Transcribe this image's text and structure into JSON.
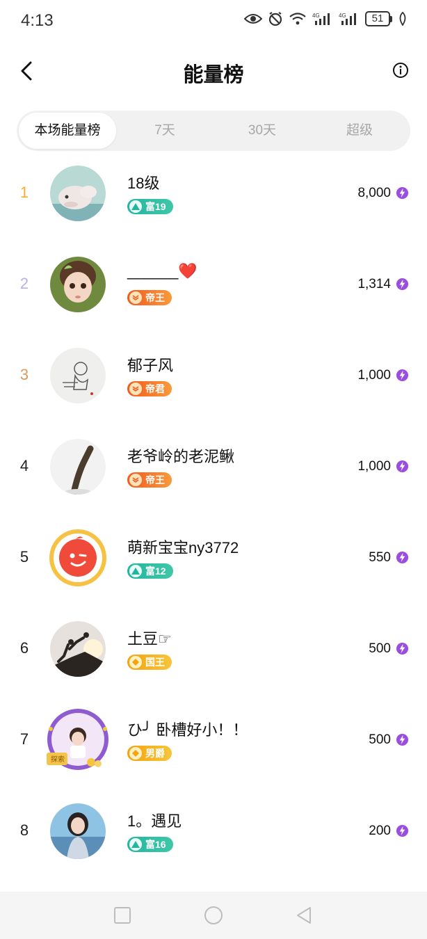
{
  "status_bar": {
    "time": "4:13",
    "battery": "51",
    "icons": [
      "eye-icon",
      "alarm-icon",
      "wifi-icon",
      "signal-4g-icon",
      "signal-4g-icon",
      "battery-icon",
      "leaf-icon"
    ]
  },
  "header": {
    "title": "能量榜",
    "back_icon": "chevron-left-icon",
    "info_icon": "info-icon"
  },
  "tabs": [
    {
      "label": "本场能量榜",
      "active": true
    },
    {
      "label": "7天",
      "active": false
    },
    {
      "label": "30天",
      "active": false
    },
    {
      "label": "超级",
      "active": false
    }
  ],
  "leaderboard": [
    {
      "rank": "1",
      "name": "18级",
      "badge": "富19",
      "badge_style": "green",
      "score": "8,000"
    },
    {
      "rank": "2",
      "name": "______❤️",
      "badge": "帝王",
      "badge_style": "orange",
      "score": "1,314"
    },
    {
      "rank": "3",
      "name": "郁子风",
      "badge": "帝君",
      "badge_style": "orange",
      "score": "1,000"
    },
    {
      "rank": "4",
      "name": "老爷岭的老泥鳅",
      "badge": "帝王",
      "badge_style": "orange",
      "score": "1,000"
    },
    {
      "rank": "5",
      "name": "萌新宝宝ny3772",
      "badge": "富12",
      "badge_style": "green",
      "score": "550"
    },
    {
      "rank": "6",
      "name": "土豆☞",
      "badge": "国王",
      "badge_style": "gold",
      "score": "500"
    },
    {
      "rank": "7",
      "name": "ひ╯ 卧槽好小！！",
      "badge": "男爵",
      "badge_style": "gold",
      "score": "500"
    },
    {
      "rank": "8",
      "name": "1。遇见",
      "badge": "富16",
      "badge_style": "green",
      "score": "200"
    }
  ],
  "frame_label": "探索",
  "colors": {
    "rank1": "#f2b12c",
    "rank2": "#b0b3e8",
    "rank3": "#d89b5a",
    "energy": "#9b4de0",
    "badge_green": "#22b6a1",
    "badge_orange": "#f25a1e",
    "badge_gold": "#f3a30f"
  },
  "nav": [
    "recent-apps-button",
    "home-button",
    "back-button"
  ]
}
